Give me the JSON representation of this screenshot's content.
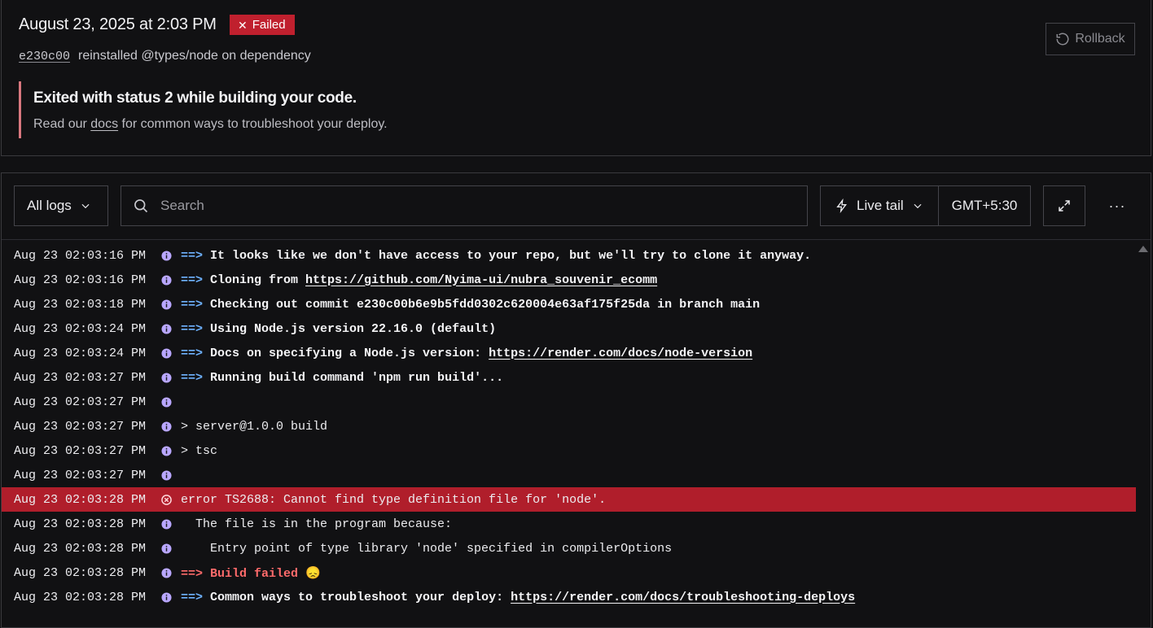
{
  "deploy": {
    "title": "August 23, 2025 at 2:03 PM",
    "status": "Failed",
    "commit_hash": "e230c00",
    "commit_message": "reinstalled @types/node on dependency",
    "rollback_label": "Rollback"
  },
  "error_callout": {
    "heading": "Exited with status 2 while building your code.",
    "help_prefix": "Read our ",
    "help_link": "docs",
    "help_suffix": " for common ways to troubleshoot your deploy."
  },
  "toolbar": {
    "filter_label": "All logs",
    "search_placeholder": "Search",
    "live_tail_label": "Live tail",
    "timezone": "GMT+5:30"
  },
  "colors": {
    "failed_badge": "#c0202e",
    "error_row": "#b01e2b",
    "info_icon": "#b9a7ff",
    "arrow_blue": "#6fb3ff",
    "arrow_red": "#ff6b6b"
  },
  "logs": [
    {
      "time": "Aug 23 02:03:16 PM",
      "level": "info",
      "arrow": "==>",
      "text": "It looks like we don't have access to your repo, but we'll try to clone it anyway."
    },
    {
      "time": "Aug 23 02:03:16 PM",
      "level": "info",
      "arrow": "==>",
      "text": "Cloning from ",
      "link": "https://github.com/Nyima-ui/nubra_souvenir_ecomm"
    },
    {
      "time": "Aug 23 02:03:18 PM",
      "level": "info",
      "arrow": "==>",
      "text": "Checking out commit e230c00b6e9b5fdd0302c620004e63af175f25da in branch main"
    },
    {
      "time": "Aug 23 02:03:24 PM",
      "level": "info",
      "arrow": "==>",
      "text": "Using Node.js version 22.16.0 (default)"
    },
    {
      "time": "Aug 23 02:03:24 PM",
      "level": "info",
      "arrow": "==>",
      "text": "Docs on specifying a Node.js version: ",
      "link": "https://render.com/docs/node-version"
    },
    {
      "time": "Aug 23 02:03:27 PM",
      "level": "info",
      "arrow": "==>",
      "text": "Running build command 'npm run build'..."
    },
    {
      "time": "Aug 23 02:03:27 PM",
      "level": "info",
      "plain": ""
    },
    {
      "time": "Aug 23 02:03:27 PM",
      "level": "info",
      "plain": "> server@1.0.0 build"
    },
    {
      "time": "Aug 23 02:03:27 PM",
      "level": "info",
      "plain": "> tsc"
    },
    {
      "time": "Aug 23 02:03:27 PM",
      "level": "info",
      "plain": ""
    },
    {
      "time": "Aug 23 02:03:28 PM",
      "level": "error",
      "plain": "error TS2688: Cannot find type definition file for 'node'."
    },
    {
      "time": "Aug 23 02:03:28 PM",
      "level": "info",
      "plain": "  The file is in the program because:"
    },
    {
      "time": "Aug 23 02:03:28 PM",
      "level": "info",
      "plain": "    Entry point of type library 'node' specified in compilerOptions"
    },
    {
      "time": "Aug 23 02:03:28 PM",
      "level": "info",
      "arrow": "==>",
      "arrow_red": true,
      "text": "Build failed 😞"
    },
    {
      "time": "Aug 23 02:03:28 PM",
      "level": "info",
      "arrow": "==>",
      "text": "Common ways to troubleshoot your deploy: ",
      "link": "https://render.com/docs/troubleshooting-deploys"
    }
  ]
}
